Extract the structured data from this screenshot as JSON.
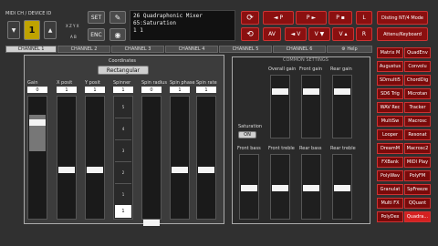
{
  "midi": {
    "header": "MIDI CH / DEVICE ID",
    "value": "1",
    "left_glyph": "▼",
    "right_glyph": "▲",
    "xyz": "X Z Y X",
    "ab": "A B",
    "set": "SET",
    "enc": "ENC",
    "pencil": "✎",
    "dial": "◉"
  },
  "display": {
    "line1": "26 Quadraphonic Mixer",
    "line2": "65:Saturation",
    "line3": "1    1"
  },
  "toolbar": {
    "refresh": "⟳",
    "back": "⟲",
    "p_left": "◄ P",
    "p_right": "P ►",
    "p_min": "P ▪",
    "p_max": "P ▴",
    "l": "L",
    "r": "R",
    "av": "AV",
    "v_left": "◄ V",
    "v_right": "V ▼",
    "v_max": "V ▴",
    "prev_file": "⇄",
    "next_file": "⇆"
  },
  "mode": {
    "distingnt": "Disting NT/4 Mode",
    "attenuverter": "Attenu/Keyboard"
  },
  "tabs": [
    "CHANNEL 1",
    "CHANNEL 2",
    "CHANNEL 3",
    "CHANNEL 4",
    "CHANNEL 5",
    "CHANNEL 6",
    "⚙ Help"
  ],
  "coord": {
    "label": "Coordinates",
    "value": "Rectangular"
  },
  "sliders": [
    {
      "label": "Gain",
      "value": "0"
    },
    {
      "label": "X posit",
      "value": "1"
    },
    {
      "label": "Y posit",
      "value": "1"
    },
    {
      "label": "Spinner",
      "value": "1"
    },
    {
      "label": "Spin radius",
      "value": "0"
    },
    {
      "label": "Spin phase",
      "value": "1"
    },
    {
      "label": "Spin rate",
      "value": "1"
    }
  ],
  "spinner_steps": [
    "5",
    "4",
    "3",
    "2",
    "1"
  ],
  "slider_labels": {
    "a": "off",
    "b": "mid"
  },
  "common": {
    "title": "COMMON SETTINGS",
    "saturation_label": "Saturation",
    "saturation_value": "ON",
    "gains": [
      "Overall gain",
      "Front gain",
      "Rear gain"
    ],
    "bass_treble": [
      "Front bass",
      "Front treble",
      "Rear bass",
      "Rear treble"
    ]
  },
  "fx": [
    [
      "Matrix M",
      "QuadEnv"
    ],
    [
      "Augustus",
      "Convolu"
    ],
    [
      "SDmulti5",
      "ChordDig"
    ],
    [
      "SD6 Trig",
      "Microtan"
    ],
    [
      "WAV Rec",
      "Tracker"
    ],
    [
      "MultiSw",
      "Macrosc"
    ],
    [
      "Looper",
      "Resonat"
    ],
    [
      "DreamM",
      "Macrosc2"
    ],
    [
      "FXBank",
      "MIDI Play"
    ],
    [
      "PolyWav",
      "PolyFM"
    ],
    [
      "Granulat",
      "SpFreeze"
    ],
    [
      "Multi FX",
      "QQuant"
    ],
    [
      "PolyDex",
      "Quadra..."
    ]
  ],
  "colors": {
    "accent_red": "#8a1010",
    "active": "#d52020"
  }
}
